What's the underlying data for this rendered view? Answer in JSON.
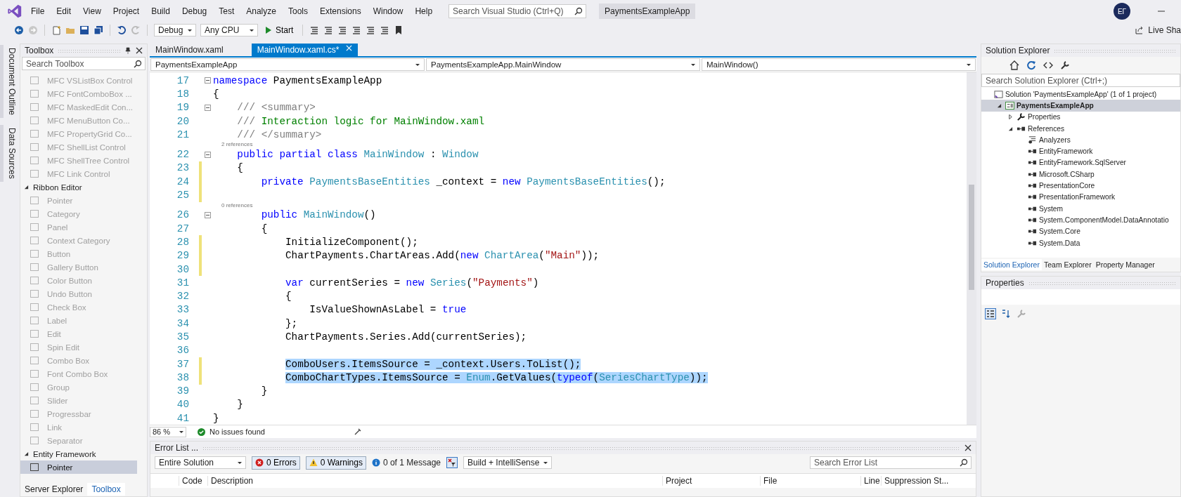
{
  "menu": [
    "File",
    "Edit",
    "View",
    "Project",
    "Build",
    "Debug",
    "Test",
    "Analyze",
    "Tools",
    "Extensions",
    "Window",
    "Help"
  ],
  "search": {
    "placeholder": "Search Visual Studio (Ctrl+Q)"
  },
  "solution_title": "PaymentsExampleApp",
  "account": {
    "initials": "ЕГ"
  },
  "live_share": "Live Sha",
  "toolbar": {
    "configuration": "Debug",
    "platform": "Any CPU",
    "start": "Start"
  },
  "side_strip": [
    "Document Outline",
    "Data Sources"
  ],
  "toolbox": {
    "title": "Toolbox",
    "search_placeholder": "Search Toolbox",
    "items": [
      {
        "label": "MFC VSListBox Control",
        "disabled": true,
        "selected": false
      },
      {
        "label": "MFC FontComboBox ...",
        "disabled": true,
        "selected": false
      },
      {
        "label": "MFC MaskedEdit Con...",
        "disabled": true,
        "selected": false
      },
      {
        "label": "MFC MenuButton Co...",
        "disabled": true,
        "selected": false
      },
      {
        "label": "MFC PropertyGrid Co...",
        "disabled": true,
        "selected": false
      },
      {
        "label": "MFC ShellList Control",
        "disabled": true,
        "selected": false
      },
      {
        "label": "MFC ShellTree Control",
        "disabled": true,
        "selected": false
      },
      {
        "label": "MFC Link Control",
        "disabled": true,
        "selected": false
      }
    ],
    "groups": [
      {
        "label": "Ribbon Editor",
        "expanded": true,
        "items": [
          {
            "label": "Pointer",
            "disabled": true,
            "selected": false
          },
          {
            "label": "Category",
            "disabled": true,
            "selected": false
          },
          {
            "label": "Panel",
            "disabled": true,
            "selected": false
          },
          {
            "label": "Context Category",
            "disabled": true,
            "selected": false
          },
          {
            "label": "Button",
            "disabled": true,
            "selected": false
          },
          {
            "label": "Gallery Button",
            "disabled": true,
            "selected": false
          },
          {
            "label": "Color Button",
            "disabled": true,
            "selected": false
          },
          {
            "label": "Undo Button",
            "disabled": true,
            "selected": false
          },
          {
            "label": "Check Box",
            "disabled": true,
            "selected": false
          },
          {
            "label": "Label",
            "disabled": true,
            "selected": false
          },
          {
            "label": "Edit",
            "disabled": true,
            "selected": false
          },
          {
            "label": "Spin Edit",
            "disabled": true,
            "selected": false
          },
          {
            "label": "Combo Box",
            "disabled": true,
            "selected": false
          },
          {
            "label": "Font Combo Box",
            "disabled": true,
            "selected": false
          },
          {
            "label": "Group",
            "disabled": true,
            "selected": false
          },
          {
            "label": "Slider",
            "disabled": true,
            "selected": false
          },
          {
            "label": "Progressbar",
            "disabled": true,
            "selected": false
          },
          {
            "label": "Link",
            "disabled": true,
            "selected": false
          },
          {
            "label": "Separator",
            "disabled": true,
            "selected": false
          }
        ]
      },
      {
        "label": "Entity Framework",
        "expanded": true,
        "items": [
          {
            "label": "Pointer",
            "disabled": false,
            "selected": true
          }
        ]
      }
    ],
    "bottom_tabs": [
      {
        "label": "Server Explorer",
        "selected": false
      },
      {
        "label": "Toolbox",
        "selected": true
      }
    ]
  },
  "editor": {
    "tabs": [
      {
        "label": "MainWindow.xaml",
        "selected": false
      },
      {
        "label": "MainWindow.xaml.cs*",
        "selected": true
      }
    ],
    "nav": [
      "PaymentsExampleApp",
      "PaymentsExampleApp.MainWindow",
      "MainWindow()"
    ],
    "lines": [
      {
        "number": "17",
        "fold": true,
        "changed": false,
        "selected": false,
        "tokens": [
          {
            "kind": "kw",
            "text": "namespace"
          },
          {
            "kind": "text",
            "text": " PaymentsExampleApp"
          }
        ]
      },
      {
        "number": "18",
        "fold": false,
        "changed": false,
        "selected": false,
        "tokens": [
          {
            "kind": "text",
            "text": "{"
          }
        ]
      },
      {
        "number": "19",
        "fold": true,
        "changed": false,
        "selected": false,
        "tokens": [
          {
            "kind": "doc",
            "text": "    /// <summary>"
          }
        ]
      },
      {
        "number": "20",
        "fold": false,
        "changed": false,
        "selected": false,
        "tokens": [
          {
            "kind": "doc",
            "text": "    /// "
          },
          {
            "kind": "comment",
            "text": "Interaction logic for MainWindow.xaml"
          }
        ]
      },
      {
        "number": "21",
        "fold": false,
        "changed": false,
        "selected": false,
        "tokens": [
          {
            "kind": "doc",
            "text": "    /// </summary>"
          }
        ]
      },
      {
        "number": "22",
        "fold": true,
        "changed": false,
        "selected": false,
        "codelens": "2 references",
        "tokens": [
          {
            "kind": "kw",
            "text": "    public partial class "
          },
          {
            "kind": "type",
            "text": "MainWindow"
          },
          {
            "kind": "text",
            "text": " : "
          },
          {
            "kind": "type",
            "text": "Window"
          }
        ]
      },
      {
        "number": "23",
        "fold": false,
        "changed": true,
        "selected": false,
        "tokens": [
          {
            "kind": "text",
            "text": "    {"
          }
        ]
      },
      {
        "number": "24",
        "fold": false,
        "changed": true,
        "selected": false,
        "tokens": [
          {
            "kind": "kw",
            "text": "        private "
          },
          {
            "kind": "type",
            "text": "PaymentsBaseEntities"
          },
          {
            "kind": "text",
            "text": " _context = "
          },
          {
            "kind": "kw",
            "text": "new "
          },
          {
            "kind": "type",
            "text": "PaymentsBaseEntities"
          },
          {
            "kind": "text",
            "text": "();"
          }
        ]
      },
      {
        "number": "25",
        "fold": false,
        "changed": true,
        "selected": false
      },
      {
        "number": "26",
        "fold": true,
        "changed": false,
        "selected": false,
        "codelens": "0 references",
        "tokens": [
          {
            "kind": "kw",
            "text": "        public "
          },
          {
            "kind": "type",
            "text": "MainWindow"
          },
          {
            "kind": "text",
            "text": "()"
          }
        ]
      },
      {
        "number": "27",
        "fold": false,
        "changed": false,
        "selected": false,
        "tokens": [
          {
            "kind": "text",
            "text": "        {"
          }
        ]
      },
      {
        "number": "28",
        "fold": false,
        "changed": true,
        "selected": false,
        "tokens": [
          {
            "kind": "text",
            "text": "            InitializeComponent();"
          }
        ]
      },
      {
        "number": "29",
        "fold": false,
        "changed": true,
        "selected": false,
        "tokens": [
          {
            "kind": "text",
            "text": "            ChartPayments.ChartAreas.Add("
          },
          {
            "kind": "kw",
            "text": "new "
          },
          {
            "kind": "type",
            "text": "ChartArea"
          },
          {
            "kind": "text",
            "text": "("
          },
          {
            "kind": "string",
            "text": "\"Main\""
          },
          {
            "kind": "text",
            "text": "));"
          }
        ]
      },
      {
        "number": "30",
        "fold": false,
        "changed": true,
        "selected": false
      },
      {
        "number": "31",
        "fold": false,
        "changed": false,
        "selected": false,
        "tokens": [
          {
            "kind": "kw",
            "text": "            var"
          },
          {
            "kind": "text",
            "text": " currentSeries = "
          },
          {
            "kind": "kw",
            "text": "new "
          },
          {
            "kind": "type",
            "text": "Series"
          },
          {
            "kind": "text",
            "text": "("
          },
          {
            "kind": "string",
            "text": "\"Payments\""
          },
          {
            "kind": "text",
            "text": ")"
          }
        ]
      },
      {
        "number": "32",
        "fold": false,
        "changed": false,
        "selected": false,
        "tokens": [
          {
            "kind": "text",
            "text": "            {"
          }
        ]
      },
      {
        "number": "33",
        "fold": false,
        "changed": false,
        "selected": false,
        "tokens": [
          {
            "kind": "text",
            "text": "                IsValueShownAsLabel = "
          },
          {
            "kind": "kw",
            "text": "true"
          }
        ]
      },
      {
        "number": "34",
        "fold": false,
        "changed": false,
        "selected": false,
        "tokens": [
          {
            "kind": "text",
            "text": "            };"
          }
        ]
      },
      {
        "number": "35",
        "fold": false,
        "changed": false,
        "selected": false,
        "tokens": [
          {
            "kind": "text",
            "text": "            ChartPayments.Series.Add(currentSeries);"
          }
        ]
      },
      {
        "number": "36",
        "fold": false,
        "changed": false,
        "selected": false
      },
      {
        "number": "37",
        "fold": false,
        "changed": true,
        "selected": true,
        "tokens": [
          {
            "kind": "text",
            "text": "            ComboUsers.ItemsSource = _context.Users.ToList();"
          }
        ]
      },
      {
        "number": "38",
        "fold": false,
        "changed": true,
        "selected": true,
        "tokens": [
          {
            "kind": "text",
            "text": "            ComboChartTypes.ItemsSource = "
          },
          {
            "kind": "type",
            "text": "Enum"
          },
          {
            "kind": "text",
            "text": ".GetValues("
          },
          {
            "kind": "kw",
            "text": "typeof"
          },
          {
            "kind": "text",
            "text": "("
          },
          {
            "kind": "type",
            "text": "SeriesChartType"
          },
          {
            "kind": "text",
            "text": "));"
          }
        ]
      },
      {
        "number": "39",
        "fold": false,
        "changed": false,
        "selected": false,
        "tokens": [
          {
            "kind": "text",
            "text": "        }"
          }
        ]
      },
      {
        "number": "40",
        "fold": false,
        "changed": false,
        "selected": false,
        "tokens": [
          {
            "kind": "text",
            "text": "    }"
          }
        ]
      },
      {
        "number": "41",
        "fold": false,
        "changed": false,
        "selected": false,
        "tokens": [
          {
            "kind": "text",
            "text": "}"
          }
        ]
      }
    ],
    "zoom": "86 %",
    "status": "No issues found"
  },
  "error_list": {
    "title": "Error List ...",
    "scope": "Entire Solution",
    "errors": "0 Errors",
    "warnings": "0 Warnings",
    "messages": "0 of 1 Message",
    "source": "Build + IntelliSense",
    "search_placeholder": "Search Error List",
    "columns": [
      "Code",
      "Description",
      "Project",
      "File",
      "Line",
      "Suppression St..."
    ]
  },
  "solution_explorer": {
    "title": "Solution Explorer",
    "search_placeholder": "Search Solution Explorer (Ctrl+;)",
    "tree": [
      {
        "kind": "solution",
        "label": "Solution 'PaymentsExampleApp' (1 of 1 project)",
        "selected": false,
        "children": [
          {
            "kind": "project",
            "label": "PaymentsExampleApp",
            "selected": true,
            "expanded": true,
            "children": [
              {
                "kind": "properties",
                "label": "Properties",
                "selected": false,
                "expanded": false
              },
              {
                "kind": "references",
                "label": "References",
                "selected": false,
                "expanded": true,
                "children": [
                  {
                    "kind": "analyzers",
                    "label": "Analyzers",
                    "selected": false
                  },
                  {
                    "kind": "reference",
                    "label": "EntityFramework",
                    "selected": false
                  },
                  {
                    "kind": "reference",
                    "label": "EntityFramework.SqlServer",
                    "selected": false
                  },
                  {
                    "kind": "reference",
                    "label": "Microsoft.CSharp",
                    "selected": false
                  },
                  {
                    "kind": "reference",
                    "label": "PresentationCore",
                    "selected": false
                  },
                  {
                    "kind": "reference",
                    "label": "PresentationFramework",
                    "selected": false
                  },
                  {
                    "kind": "reference",
                    "label": "System",
                    "selected": false
                  },
                  {
                    "kind": "reference",
                    "label": "System.ComponentModel.DataAnnotatio",
                    "selected": false
                  },
                  {
                    "kind": "reference",
                    "label": "System.Core",
                    "selected": false
                  },
                  {
                    "kind": "reference",
                    "label": "System.Data",
                    "selected": false
                  }
                ]
              }
            ]
          }
        ]
      }
    ],
    "tabs": [
      {
        "label": "Solution Explorer",
        "selected": true
      },
      {
        "label": "Team Explorer",
        "selected": false
      },
      {
        "label": "Property Manager",
        "selected": false
      }
    ]
  },
  "properties": {
    "title": "Properties"
  }
}
